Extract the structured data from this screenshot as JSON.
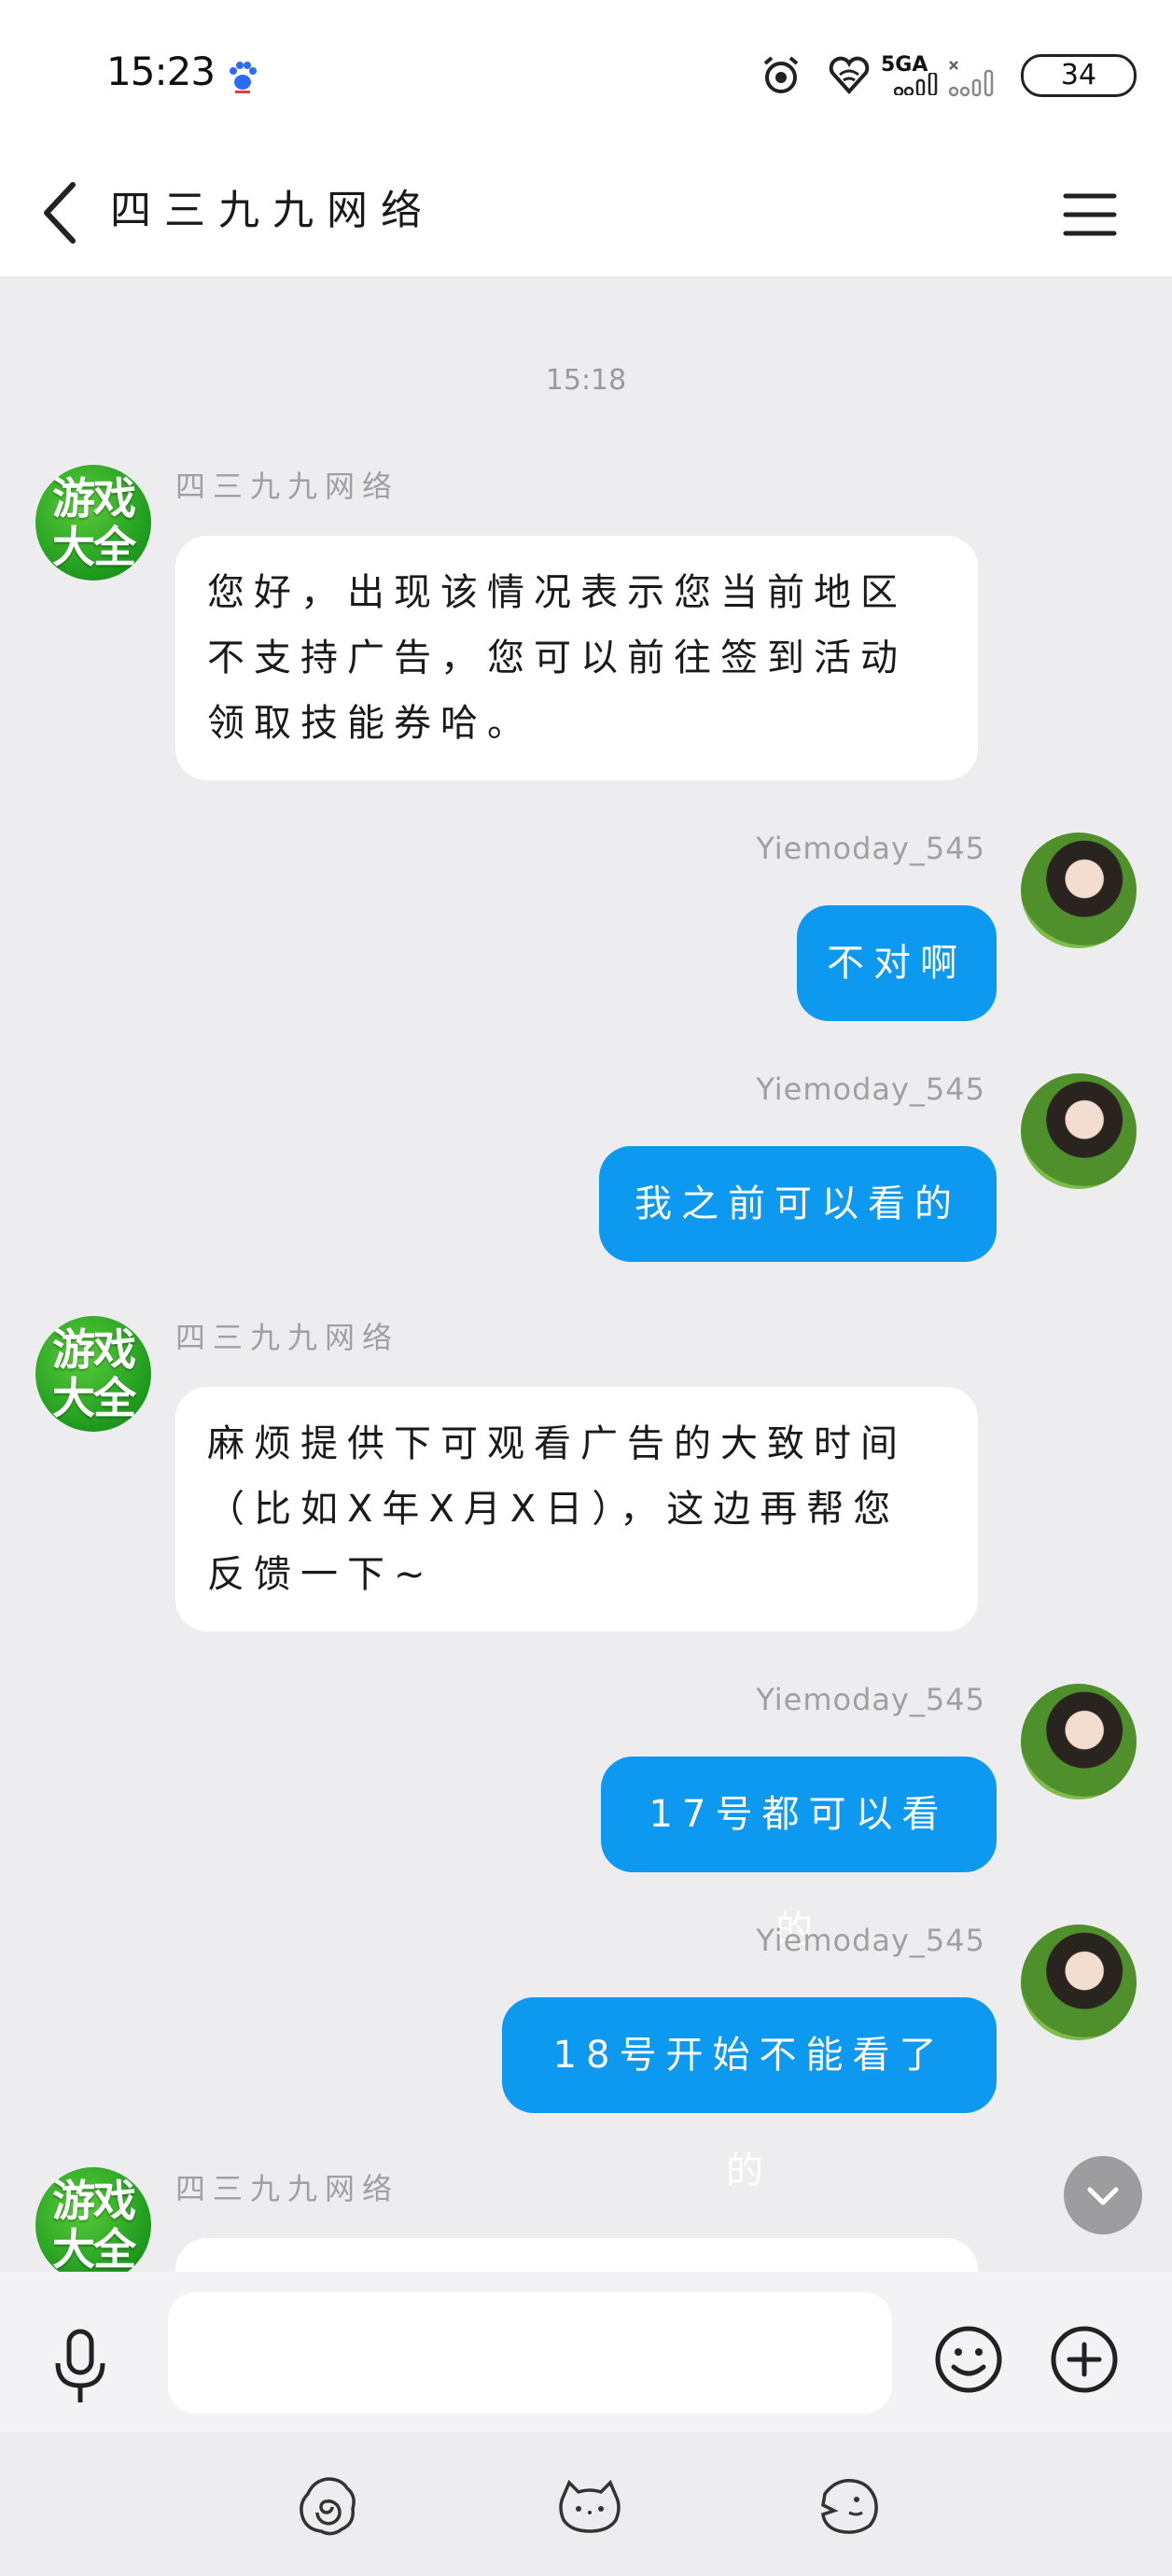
{
  "status_bar": {
    "time": "15:23",
    "battery": "34",
    "network": "5GA"
  },
  "header": {
    "title": "四三九九网络"
  },
  "chat": {
    "timestamp": "15:18",
    "messages": [
      {
        "side": "in",
        "sender": "四三九九网络",
        "avatar": "游戏\n大全",
        "text": "您好，出现该情况表示您当前地区不支持广告，您可以前往签到活动领取技能券哈。"
      },
      {
        "side": "out",
        "sender": "Yiemoday_545",
        "text": "不对啊"
      },
      {
        "side": "out",
        "sender": "Yiemoday_545",
        "text": "我之前可以看的"
      },
      {
        "side": "in",
        "sender": "四三九九网络",
        "avatar": "游戏\n大全",
        "text": "麻烦提供下可观看广告的大致时间（比如X年X月X日），这边再帮您反馈一下~"
      },
      {
        "side": "out",
        "sender": "Yiemoday_545",
        "text": "17号都可以看的"
      },
      {
        "side": "out",
        "sender": "Yiemoday_545",
        "text": "18号开始不能看了的"
      },
      {
        "side": "in",
        "sender": "四三九九网络",
        "avatar": "游戏\n大全",
        "text": ""
      }
    ]
  },
  "input": {
    "value": "",
    "placeholder": ""
  },
  "icons": {
    "back": "back-arrow-icon",
    "menu": "hamburger-menu-icon",
    "mic": "microphone-icon",
    "emoji": "emoji-icon",
    "plus": "plus-icon",
    "scroll_down": "chevron-down-icon"
  },
  "colors": {
    "outgoing_bubble": "#0d99f0",
    "background": "#ededf0"
  }
}
